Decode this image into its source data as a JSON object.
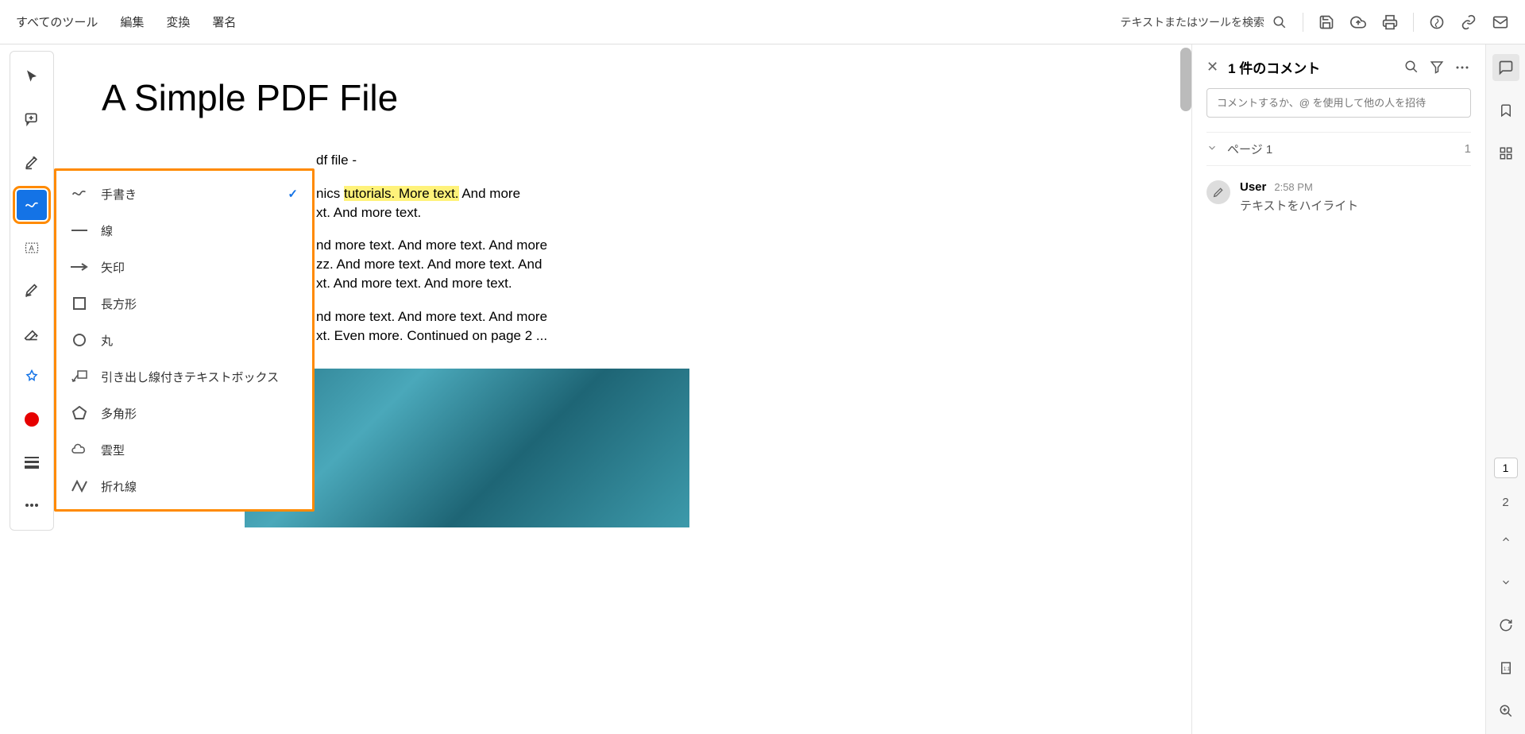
{
  "top_menu": {
    "all_tools": "すべてのツール",
    "edit": "編集",
    "convert": "変換",
    "sign": "署名",
    "search_label": "テキストまたはツールを検索"
  },
  "dropdown": {
    "items": [
      {
        "label": "手書き",
        "checked": true
      },
      {
        "label": "線",
        "checked": false
      },
      {
        "label": "矢印",
        "checked": false
      },
      {
        "label": "長方形",
        "checked": false
      },
      {
        "label": "丸",
        "checked": false
      },
      {
        "label": "引き出し線付きテキストボックス",
        "checked": false
      },
      {
        "label": "多角形",
        "checked": false
      },
      {
        "label": "雲型",
        "checked": false
      },
      {
        "label": "折れ線",
        "checked": false
      }
    ]
  },
  "document": {
    "title": "A Simple PDF File",
    "line1_suffix": "df file -",
    "para2_pre": "nics ",
    "para2_hl": "tutorials. More text.",
    "para2_post": " And more",
    "para2_line2": "xt. And more text.",
    "para3_l1": "nd more text. And more text. And more",
    "para3_l2": "zz. And more text. And more text. And",
    "para3_l3": "xt. And more text.  And more text.",
    "para4_l1": "nd more text. And more text. And more",
    "para4_l2": "xt. Even more. Continued on page 2 ..."
  },
  "comments": {
    "title": "1 件のコメント",
    "input_placeholder": "コメントするか、@ を使用して他の人を招待",
    "page_label": "ページ 1",
    "page_count": "1",
    "user": "User",
    "time": "2:58 PM",
    "text": "テキストをハイライト"
  },
  "right_bar": {
    "current_page": "1",
    "total_pages": "2"
  }
}
